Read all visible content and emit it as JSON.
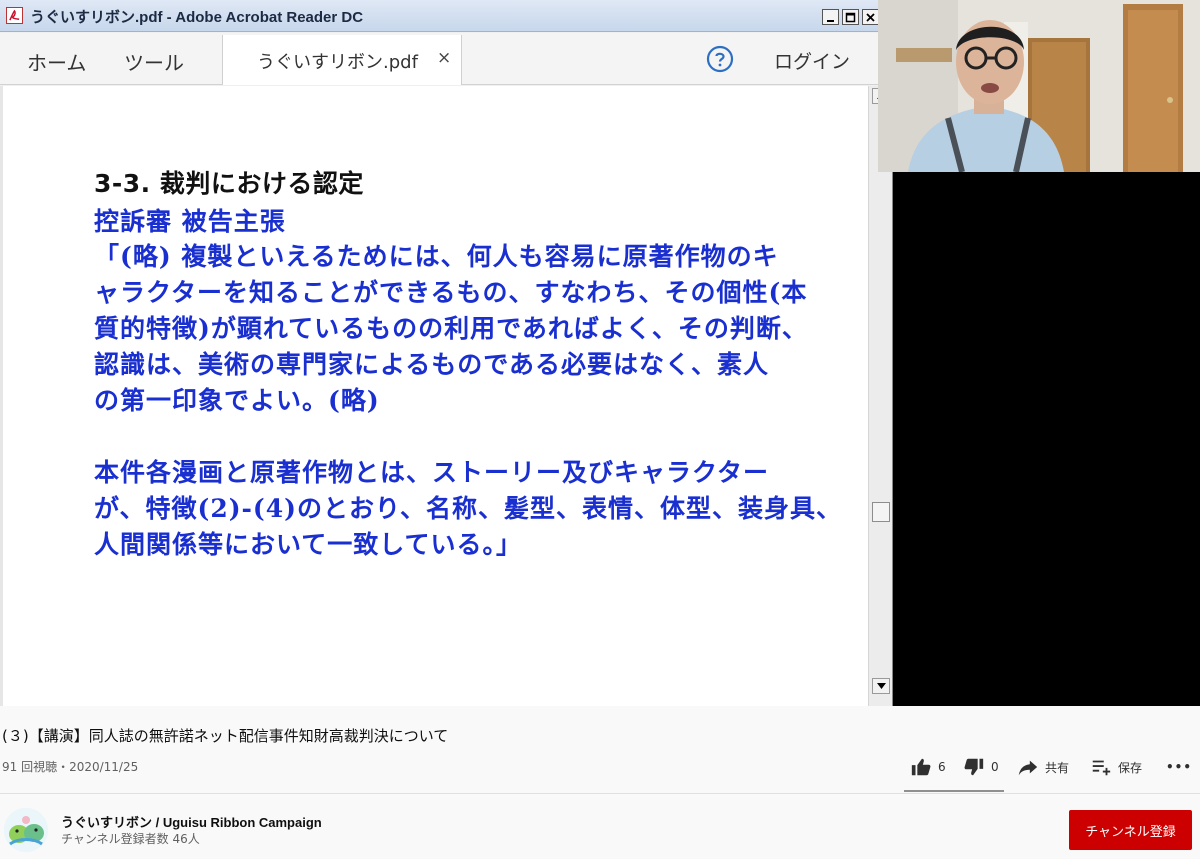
{
  "acrobat": {
    "window_title": "うぐいすリボン.pdf - Adobe Acrobat Reader DC",
    "menu": {
      "home": "ホーム",
      "tools": "ツール",
      "login": "ログイン"
    },
    "document_tab": {
      "label": "うぐいすリボン.pdf",
      "close": "×"
    },
    "slide": {
      "heading": "3-3.  裁判における認定",
      "lines": [
        "控訴審  被告主張",
        "「(略) 複製といえるためには、何人も容易に原著作物のキ",
        "ャラクターを知ることができるもの、すなわち、その個性(本",
        "質的特徴)が顕れているものの利用であればよく、その判断、",
        "認識は、美術の専門家によるものである必要はなく、素人",
        "の第一印象でよい。(略)",
        "",
        "本件各漫画と原著作物とは、ストーリー及びキャラクター",
        "が、特徴(2)-(4)のとおり、名称、髪型、表情、体型、装身具、",
        "人間関係等において一致している。」"
      ]
    }
  },
  "video": {
    "title": "(３)【講演】同人誌の無許諾ネット配信事件知財高裁判決について",
    "meta": "91 回視聴・2020/11/25"
  },
  "actions": {
    "like_count": "6",
    "dislike_count": "0",
    "share_label": "共有",
    "save_label": "保存",
    "more_label": "•••"
  },
  "channel": {
    "name": "うぐいすリボン / Uguisu Ribbon Campaign",
    "subscribers": "チャンネル登録者数 46人",
    "subscribe_label": "チャンネル登録"
  },
  "colors": {
    "slide_text_blue": "#1a2fd0",
    "subscribe_red": "#cc0000",
    "titlebar": "#c7d7ec"
  }
}
